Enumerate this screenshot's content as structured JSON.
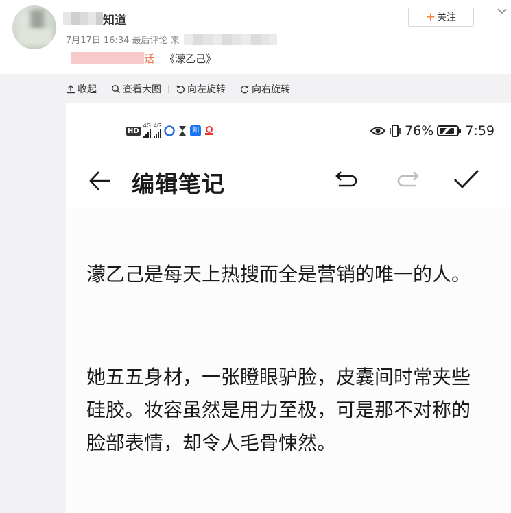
{
  "post": {
    "username_visible": "知道",
    "meta": "7月17日 16:34 最后评论 来",
    "source_link": "话",
    "source_title": "《濛乙己》",
    "follow_label": "关注"
  },
  "toolbar": {
    "items": [
      {
        "label": "收起",
        "icon": "collapse-icon"
      },
      {
        "label": "查看大图",
        "icon": "search-icon"
      },
      {
        "label": "向左旋转",
        "icon": "rotate-left-icon"
      },
      {
        "label": "向右旋转",
        "icon": "rotate-right-icon"
      }
    ]
  },
  "phone": {
    "status": {
      "hd": "HD",
      "signal_label": "4G",
      "battery": "76%",
      "time": "7:59"
    },
    "appbar": {
      "title": "编辑笔记"
    },
    "note": {
      "paragraphs": [
        "濛乙己是每天上热搜而全是营销的唯一的人。",
        "她五五身材，一张瞪眼驴脸，皮囊间时常夹些硅胶。妆容虽然是用力至极，可是那不对称的脸部表情，却令人毛骨悚然。"
      ]
    }
  },
  "colors": {
    "accent": "#eb7350",
    "follow_plus": "#ff8140",
    "panel_bg": "#f2f2f5"
  }
}
